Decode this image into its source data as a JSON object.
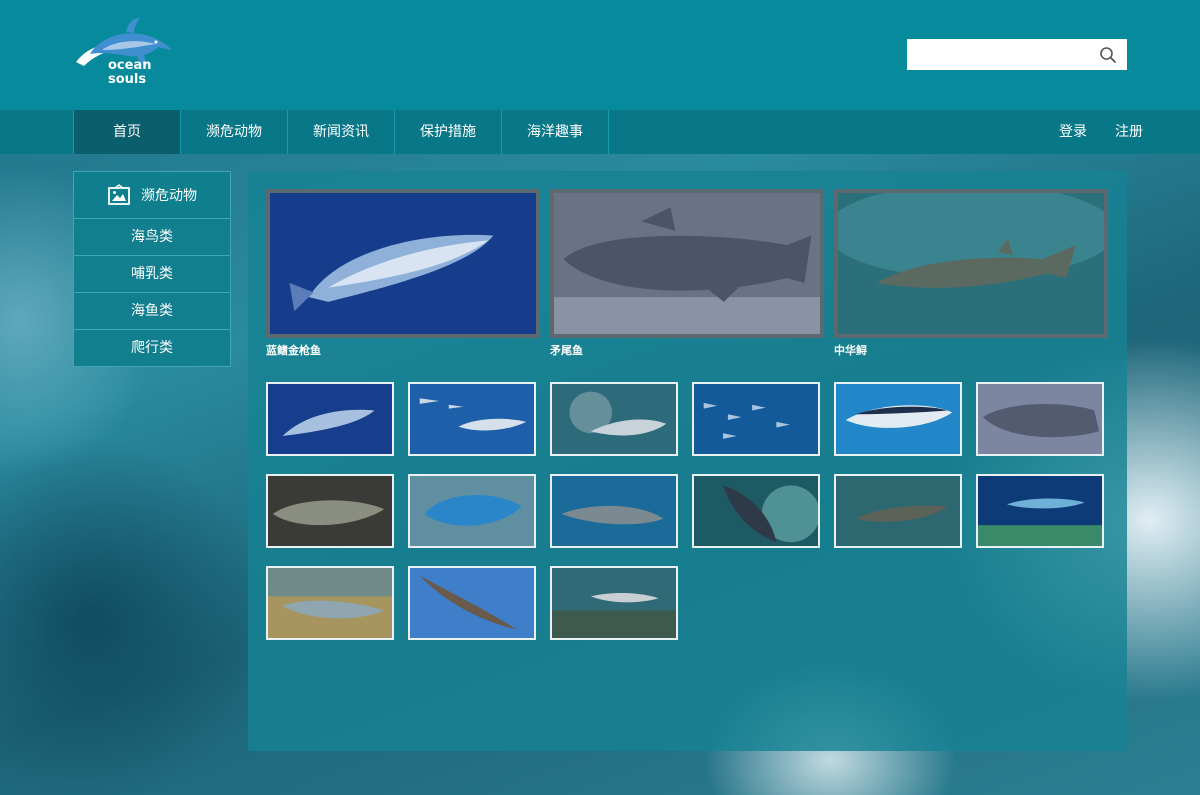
{
  "header": {
    "logo_line1": "ocean",
    "logo_line2": "souls",
    "search": {
      "value": "",
      "placeholder": ""
    }
  },
  "nav": {
    "items": [
      "首页",
      "濒危动物",
      "新闻资讯",
      "保护措施",
      "海洋趣事"
    ],
    "login": "登录",
    "register": "注册"
  },
  "sidebar": {
    "title": "濒危动物",
    "items": [
      "海鸟类",
      "哺乳类",
      "海鱼类",
      "爬行类"
    ]
  },
  "featured": [
    {
      "caption": "蓝鳍金枪鱼"
    },
    {
      "caption": "矛尾鱼"
    },
    {
      "caption": "中华鲟"
    }
  ],
  "colors": {
    "header_bg": "#078a9c",
    "nav_bg": "#087888",
    "nav_active_bg": "#0b5e6c",
    "panel_bg": "#1682948"
  }
}
